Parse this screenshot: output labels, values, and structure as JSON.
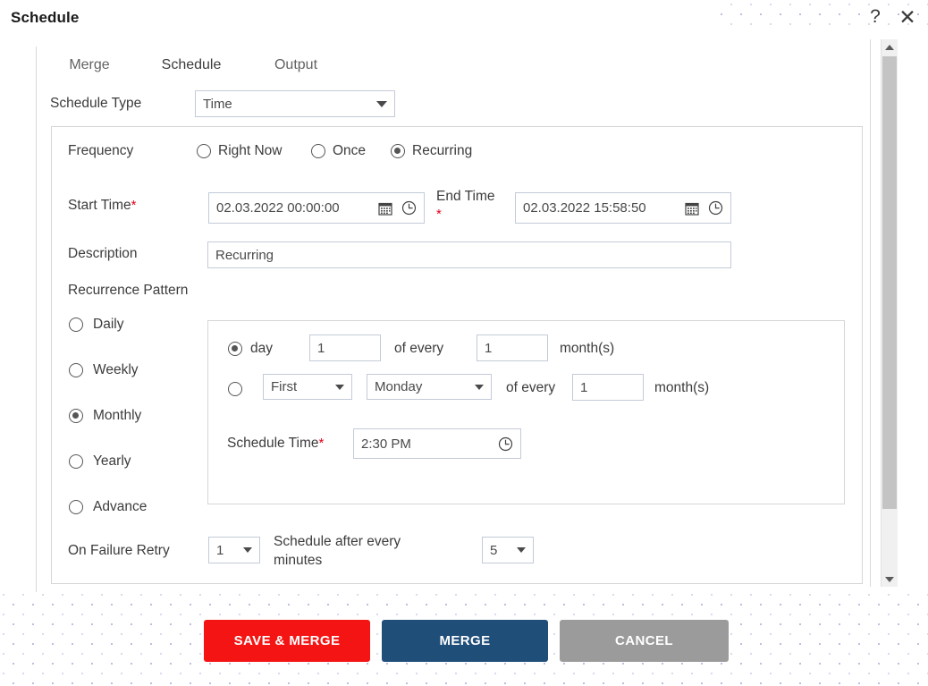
{
  "window": {
    "title": "Schedule",
    "help_icon": "?",
    "close_icon": "✕"
  },
  "tabs": [
    {
      "label": "Merge",
      "active": false
    },
    {
      "label": "Schedule",
      "active": true
    },
    {
      "label": "Output",
      "active": false
    }
  ],
  "form": {
    "schedule_type_label": "Schedule Type",
    "schedule_type_value": "Time",
    "frequency_label": "Frequency",
    "frequency_options": [
      {
        "label": "Right Now",
        "selected": false
      },
      {
        "label": "Once",
        "selected": false
      },
      {
        "label": "Recurring",
        "selected": true
      }
    ],
    "start_time_label": "Start Time",
    "start_time_value": "02.03.2022 00:00:00",
    "end_time_label": "End Time",
    "end_time_value": "02.03.2022 15:58:50",
    "required_marker": "*",
    "description_label": "Description",
    "description_value": "Recurring",
    "recurrence_pattern_label": "Recurrence Pattern",
    "recurrence_options": [
      {
        "label": "Daily",
        "selected": false
      },
      {
        "label": "Weekly",
        "selected": false
      },
      {
        "label": "Monthly",
        "selected": true
      },
      {
        "label": "Yearly",
        "selected": false
      },
      {
        "label": "Advance",
        "selected": false
      }
    ],
    "monthly": {
      "mode_day_selected": true,
      "mode_ordinal_selected": false,
      "day_label": "day",
      "day_value": "1",
      "of_every_label_1": "of every",
      "every_months_value_1": "1",
      "months_label_1": "month(s)",
      "ordinal_value": "First",
      "weekday_value": "Monday",
      "of_every_label_2": "of every",
      "every_months_value_2": "1",
      "months_label_2": "month(s)",
      "schedule_time_label": "Schedule Time",
      "schedule_time_value": "2:30 PM"
    },
    "on_failure_retry_label": "On Failure Retry",
    "on_failure_retry_value": "1",
    "schedule_after_every_label": "Schedule after every minutes",
    "schedule_after_every_value": "5"
  },
  "footer": {
    "save_label": "SAVE & MERGE",
    "merge_label": "MERGE",
    "cancel_label": "CANCEL"
  },
  "colors": {
    "save": "#f41414",
    "merge": "#1f4e79",
    "cancel": "#9b9b9b",
    "required": "#e3001b"
  }
}
